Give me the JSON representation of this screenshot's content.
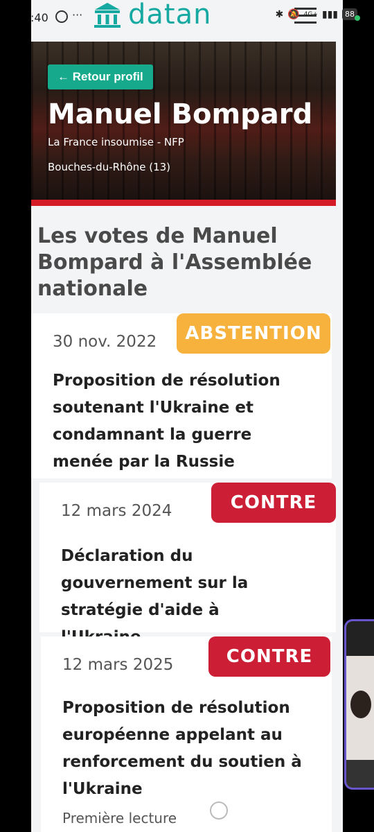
{
  "status_bar": {
    "time": ":40",
    "dots": "···",
    "network": "4G+",
    "battery": "88"
  },
  "header": {
    "logo_text": "datan"
  },
  "hero": {
    "back_label": "← Retour profil",
    "name": "Manuel Bompard",
    "party": "La France insoumise - NFP",
    "department": "Bouches-du-Rhône (13)"
  },
  "section": {
    "title": "Les votes de Manuel Bompard à l'Assemblée nationale"
  },
  "votes": [
    {
      "date": "30 nov. 2022",
      "position": "ABSTENTION",
      "title": "Proposition de résolution soutenant l'Ukraine et condamnant la guerre menée par la Russie",
      "color": "#f6b23c"
    },
    {
      "date": "12 mars 2024",
      "position": "CONTRE",
      "title": "Déclaration du gouvernement sur la stratégie d'aide à l'Ukraine",
      "color": "#cc1f35"
    },
    {
      "date": "12 mars 2025",
      "position": "CONTRE",
      "title": "Proposition de résolution européenne appelant au renforcement du soutien à l'Ukraine",
      "sub": "Première lecture",
      "color": "#cc1f35"
    }
  ],
  "colors": {
    "brand": "#16a9a1",
    "accent_red": "#d41c26",
    "back_button": "#16a98b"
  }
}
